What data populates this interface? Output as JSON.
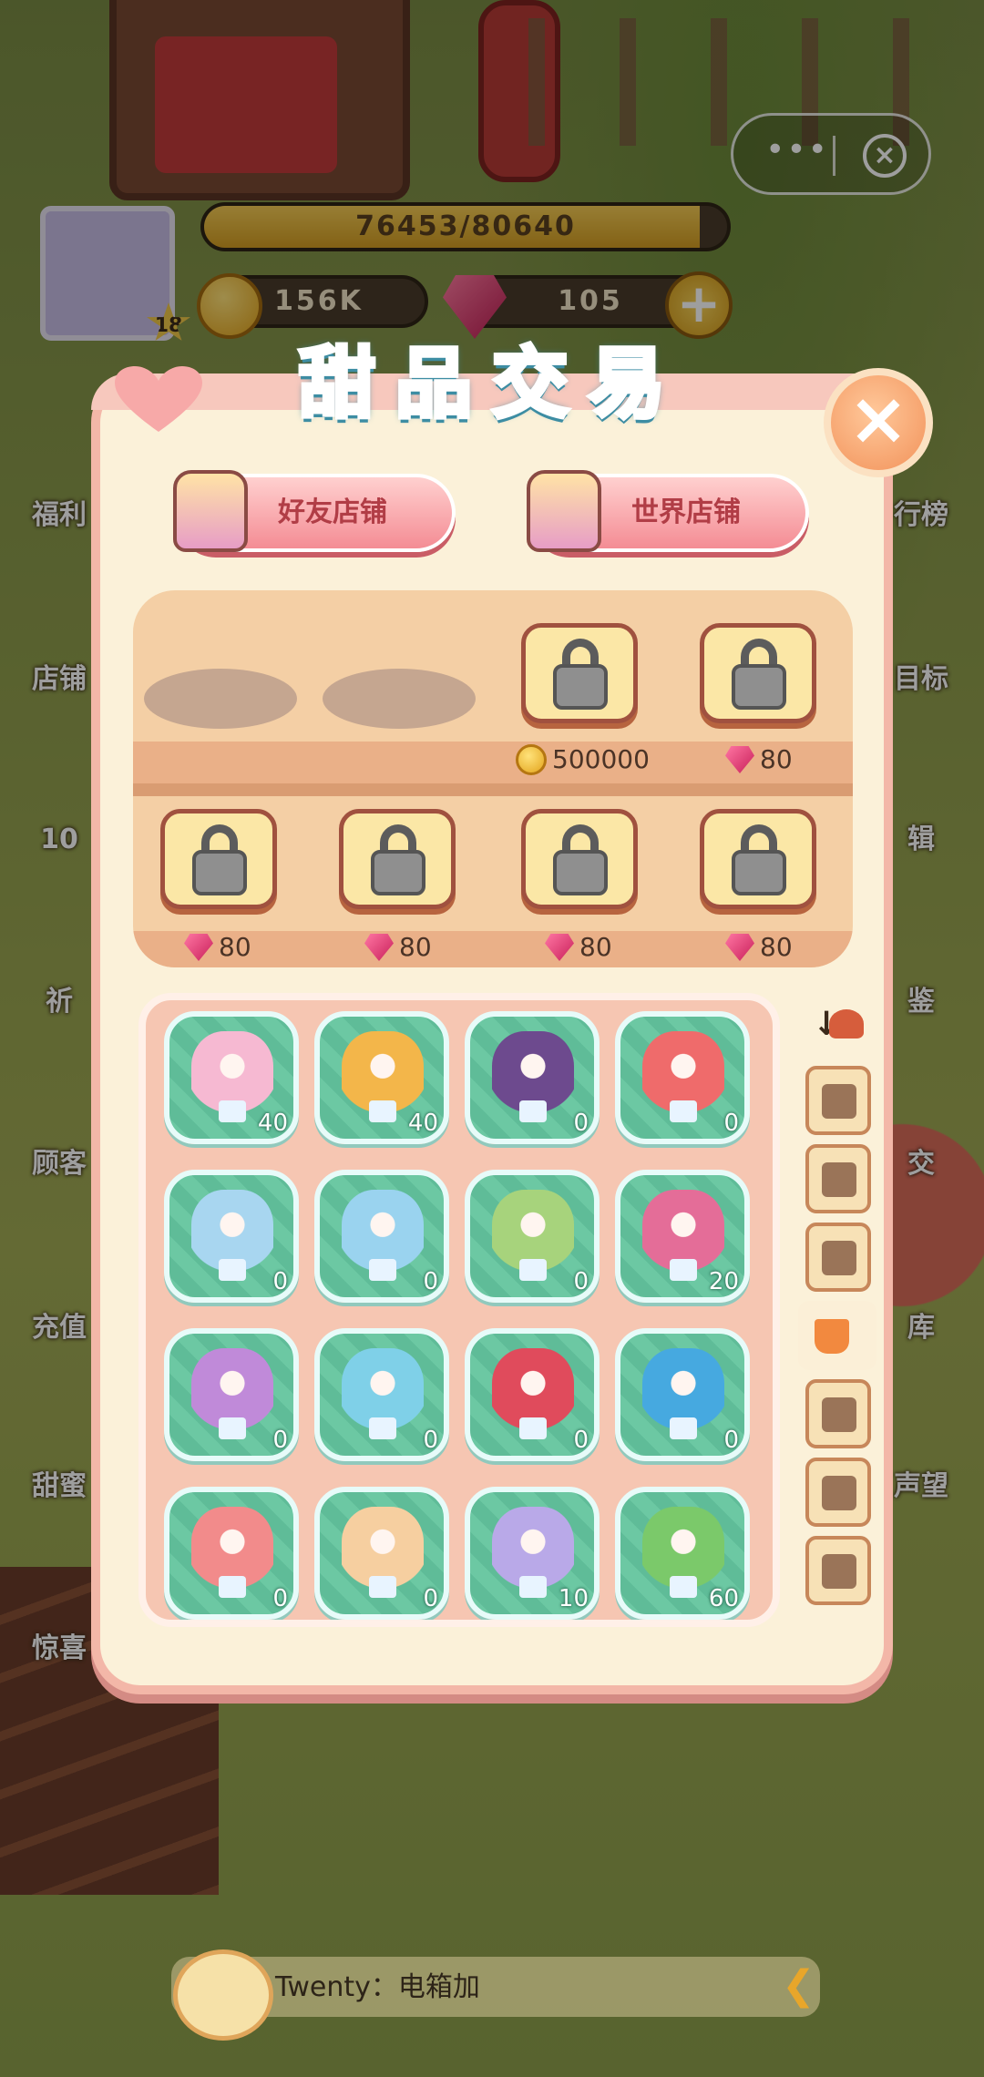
{
  "hud": {
    "level": "18",
    "exp_text": "76453/80640",
    "exp_progress": 0.948,
    "coins": "156K",
    "gems": "105"
  },
  "side_left": [
    "福利",
    "店铺",
    "10",
    "祈",
    "顾客",
    "充值",
    "甜蜜",
    "惊喜"
  ],
  "side_right": [
    "行榜",
    "目标",
    "辑",
    "鉴",
    "交",
    "库",
    "声望"
  ],
  "dialog": {
    "title": "甜品交易",
    "friend_shop": "好友店铺",
    "world_shop": "世界店铺"
  },
  "shelf": {
    "row1_prices": [
      {
        "icon": "coin-icon",
        "value": "500000"
      },
      {
        "icon": "gem-icon",
        "value": "80"
      }
    ],
    "row2_prices": [
      {
        "icon": "gem-icon",
        "value": "80"
      },
      {
        "icon": "gem-icon",
        "value": "80"
      },
      {
        "icon": "gem-icon",
        "value": "80"
      },
      {
        "icon": "gem-icon",
        "value": "80"
      }
    ]
  },
  "inventory": [
    {
      "name": "flower-cake",
      "count": "40",
      "color": "#f6b9d2"
    },
    {
      "name": "mango-parfait",
      "count": "40",
      "color": "#f3b64a"
    },
    {
      "name": "halloween-cup",
      "count": "0",
      "color": "#6d4a8e"
    },
    {
      "name": "strawberry-sundae",
      "count": "0",
      "color": "#ef6b6b"
    },
    {
      "name": "unicorn-sundae",
      "count": "0",
      "color": "#a8d6f0"
    },
    {
      "name": "berry-parfait",
      "count": "0",
      "color": "#9ad3ef"
    },
    {
      "name": "matcha-bowl",
      "count": "0",
      "color": "#a7d37c"
    },
    {
      "name": "raspberry-glass",
      "count": "20",
      "color": "#e46d98"
    },
    {
      "name": "cream-jar",
      "count": "0",
      "color": "#c08ad9"
    },
    {
      "name": "lemon-float",
      "count": "0",
      "color": "#7fd0e8"
    },
    {
      "name": "cherry-glass",
      "count": "0",
      "color": "#e04b5c"
    },
    {
      "name": "bear-float",
      "count": "0",
      "color": "#46a9e0"
    },
    {
      "name": "strawberry-cup",
      "count": "0",
      "color": "#f28b8b"
    },
    {
      "name": "citrus-drink",
      "count": "0",
      "color": "#f6cfa0"
    },
    {
      "name": "blueberry-glass",
      "count": "10",
      "color": "#b9a9e8"
    },
    {
      "name": "sunflower-float",
      "count": "60",
      "color": "#7bc96a"
    }
  ],
  "tabs": [
    "cakes",
    "slice",
    "bread",
    "drinks",
    "icecream",
    "toast",
    "cookie"
  ],
  "chat": {
    "text": "Twenty：电箱加"
  }
}
